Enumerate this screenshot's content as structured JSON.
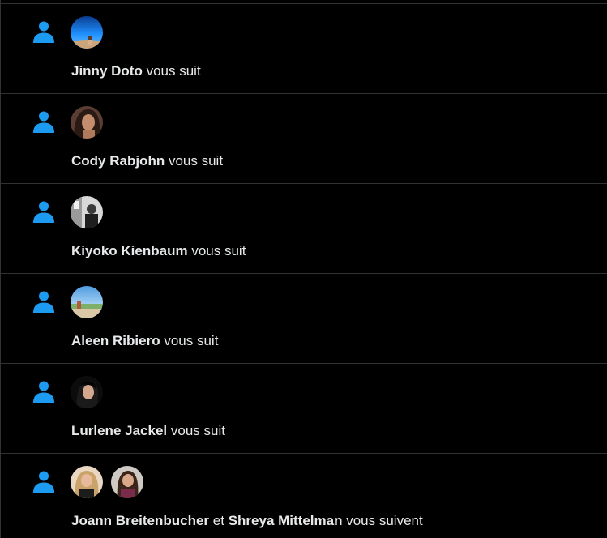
{
  "colors": {
    "background": "#000000",
    "divider": "#2f3336",
    "accent": "#1d9bf0",
    "text": "#e7e9ea"
  },
  "icons": {
    "follow": "person-icon"
  },
  "notifications": [
    {
      "names": [
        "Jinny Doto"
      ],
      "action": "vous suit"
    },
    {
      "names": [
        "Cody Rabjohn"
      ],
      "action": "vous suit"
    },
    {
      "names": [
        "Kiyoko Kienbaum"
      ],
      "action": "vous suit"
    },
    {
      "names": [
        "Aleen Ribiero"
      ],
      "action": "vous suit"
    },
    {
      "names": [
        "Lurlene Jackel"
      ],
      "action": "vous suit"
    },
    {
      "names": [
        "Joann Breitenbucher",
        "Shreya Mittelman"
      ],
      "conjunction": "et",
      "action": "vous suivent"
    }
  ]
}
